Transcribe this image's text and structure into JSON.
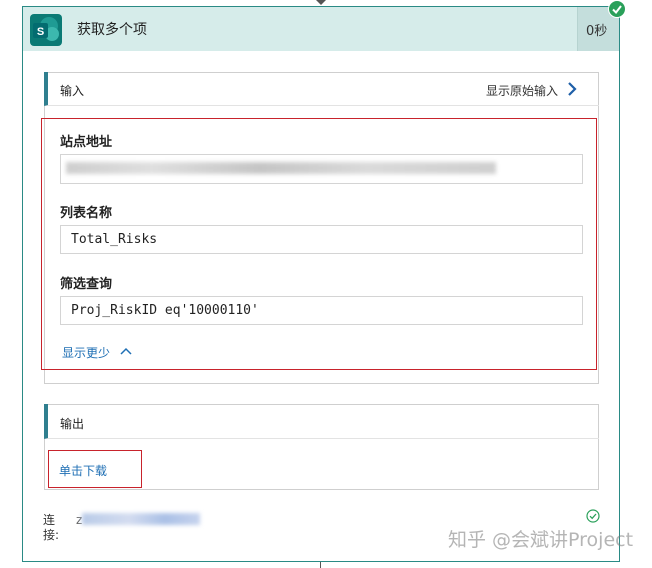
{
  "header": {
    "title": "获取多个项",
    "duration": "0秒",
    "app_icon": "sharepoint-icon",
    "status_icon": "success-check-icon"
  },
  "inputs": {
    "title": "输入",
    "raw_inputs_link": "显示原始输入",
    "fields": [
      {
        "label": "站点地址",
        "value": ""
      },
      {
        "label": "列表名称",
        "value": "Total_Risks"
      },
      {
        "label": "筛选查询",
        "value": "Proj_RiskID eq'10000110'"
      }
    ],
    "show_less": "显示更少"
  },
  "outputs": {
    "title": "输出",
    "download_link": "单击下载"
  },
  "connection": {
    "label": "连接:",
    "value": "z"
  },
  "watermark": "知乎 @会斌讲Project",
  "colors": {
    "header_bg": "#d6ecea",
    "accent": "#2f7f8f",
    "highlight": "#c8232c",
    "link": "#1f6fb4",
    "success": "#2aa05a"
  }
}
